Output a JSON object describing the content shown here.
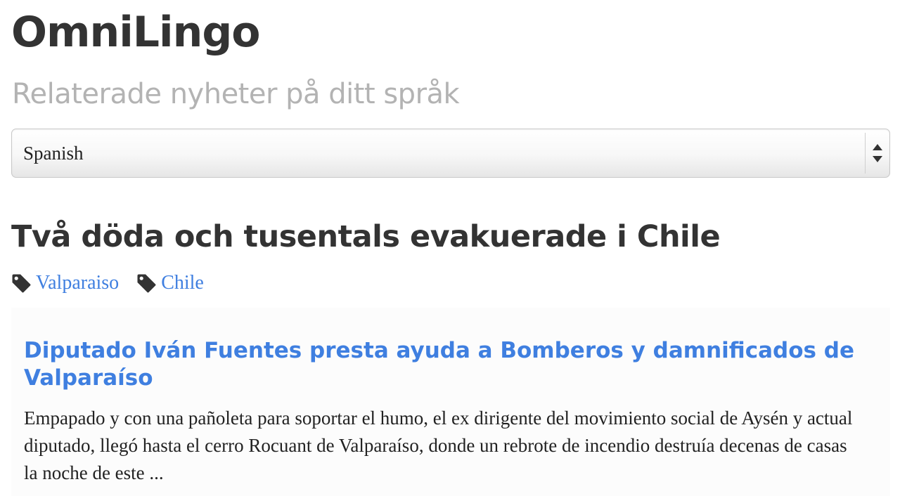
{
  "header": {
    "brand": "OmniLingo",
    "subtitle": "Relaterade nyheter på ditt språk"
  },
  "language_select": {
    "selected": "Spanish",
    "icon": "up-down-arrows-icon"
  },
  "story": {
    "headline": "Två döda och tusentals evakuerade i Chile",
    "tags": [
      {
        "label": "Valparaiso",
        "icon": "tag-icon"
      },
      {
        "label": "Chile",
        "icon": "tag-icon"
      }
    ]
  },
  "article": {
    "title": "Diputado Iván Fuentes presta ayuda a Bomberos y damnificados de Valparaíso",
    "excerpt": "Empapado y con una pañoleta para soportar el humo, el ex dirigente del movimiento social de Aysén y actual diputado, llegó hasta el cerro Rocuant de Valparaíso, donde un rebrote de incendio destruía decenas de casas la noche de este ..."
  },
  "colors": {
    "link": "#3f7fe0",
    "text": "#333333",
    "subtitle": "#b3b3b3",
    "card_background": "#fcfcfc"
  }
}
